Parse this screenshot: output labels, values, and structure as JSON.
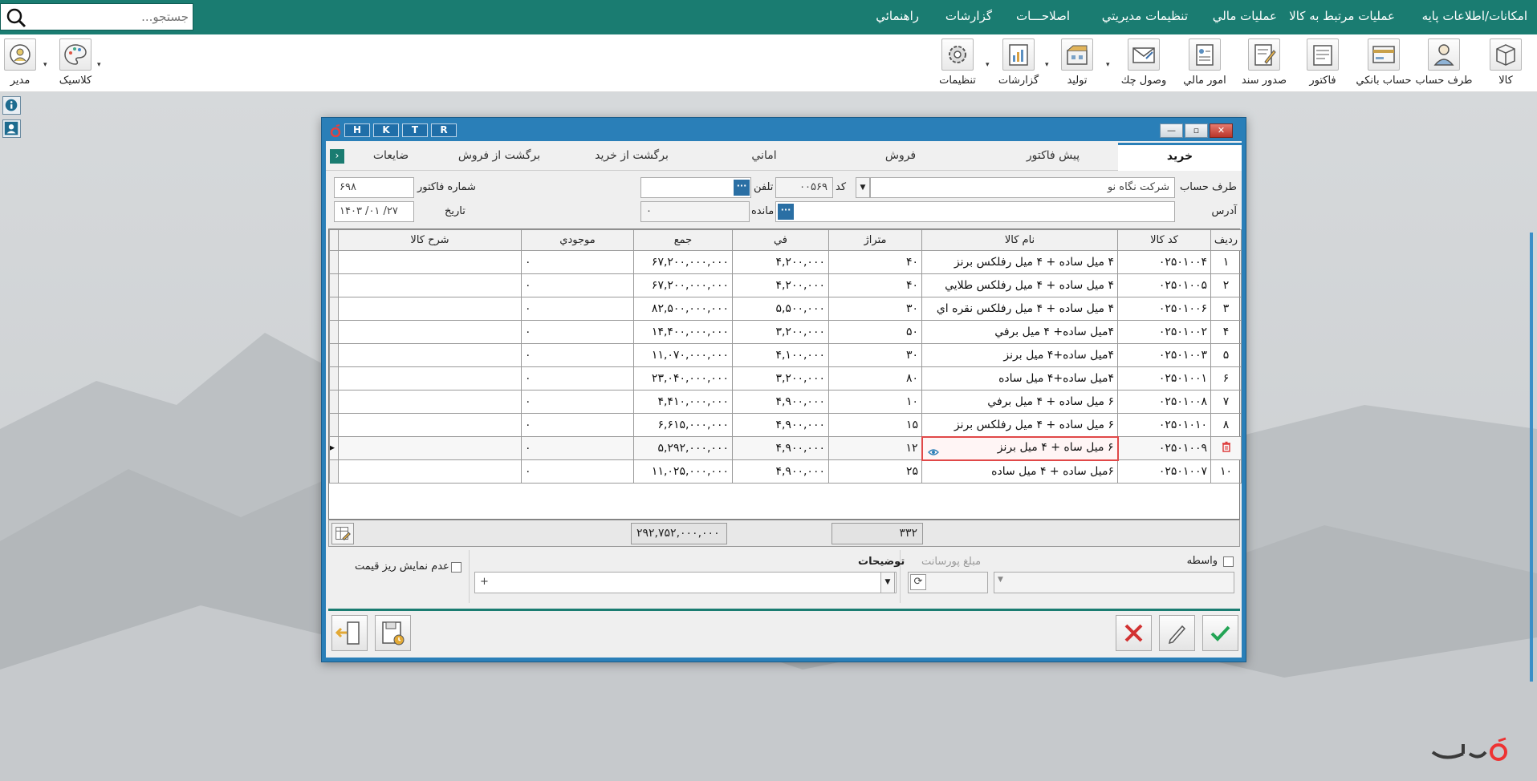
{
  "menubar": {
    "items": [
      "امکانات/اطلاعات پایه",
      "عملیات مرتبط به کالا",
      "عملیات مالي",
      "تنظيمات مديريتي",
      "اصلاحـــات",
      "گزارشات",
      "راهنمائي"
    ],
    "search_placeholder": "جستجو..."
  },
  "toolbar": {
    "items": [
      "کالا",
      "طرف حساب",
      "حساب بانکي",
      "فاکتور",
      "صدور سند",
      "امور مالي",
      "وصول چك",
      "توليد",
      "گزارشات",
      "تنظيمات"
    ],
    "left_items": [
      "مدیر",
      "کلاسیک"
    ]
  },
  "dialog": {
    "letter_buttons": [
      "H",
      "K",
      "T",
      "R"
    ],
    "tabs": [
      "خرید",
      "پیش فاکتور",
      "فروش",
      "اماني",
      "برگشت از خرید",
      "برگشت از فروش",
      "ضایعات"
    ],
    "active_tab": "خرید",
    "header": {
      "account_label": "طرف حساب",
      "account_value": "شرکت نگاه نو",
      "code_label": "کد",
      "code_value": "۰۰۵۶۹",
      "phone_label": "تلفن",
      "phone_value": "",
      "invoice_no_label": "شماره فاکتور",
      "invoice_no_value": "۶۹۸",
      "address_label": "آدرس",
      "address_value": "",
      "balance_label": "مانده",
      "balance_value": "۰",
      "date_label": "تاریخ",
      "date_value": "۱۴۰۳ /۰۱ /۲۷"
    },
    "grid": {
      "columns": [
        "ردیف",
        "کد کالا",
        "نام کالا",
        "متراژ",
        "في",
        "جمع",
        "موجودي",
        "شرح کالا"
      ],
      "rows": [
        {
          "row": "۱",
          "code": "۰۲۵۰۱۰۰۴",
          "name": "۴ میل ساده + ۴ میل رفلکس برنز",
          "qty": "۴۰",
          "price": "۴,۲۰۰,۰۰۰",
          "total": "۶۷,۲۰۰,۰۰۰,۰۰۰",
          "stock": "۰",
          "desc": ""
        },
        {
          "row": "۲",
          "code": "۰۲۵۰۱۰۰۵",
          "name": "۴ میل ساده + ۴ میل رفلکس طلایي",
          "qty": "۴۰",
          "price": "۴,۲۰۰,۰۰۰",
          "total": "۶۷,۲۰۰,۰۰۰,۰۰۰",
          "stock": "۰",
          "desc": ""
        },
        {
          "row": "۳",
          "code": "۰۲۵۰۱۰۰۶",
          "name": "۴ میل ساده + ۴ میل رفلکس نقره اي",
          "qty": "۳۰",
          "price": "۵,۵۰۰,۰۰۰",
          "total": "۸۲,۵۰۰,۰۰۰,۰۰۰",
          "stock": "۰",
          "desc": ""
        },
        {
          "row": "۴",
          "code": "۰۲۵۰۱۰۰۲",
          "name": "۴میل ساده+ ۴ میل برفي",
          "qty": "۵۰",
          "price": "۳,۲۰۰,۰۰۰",
          "total": "۱۴,۴۰۰,۰۰۰,۰۰۰",
          "stock": "۰",
          "desc": ""
        },
        {
          "row": "۵",
          "code": "۰۲۵۰۱۰۰۳",
          "name": "۴میل ساده+۴ میل برنز",
          "qty": "۳۰",
          "price": "۴,۱۰۰,۰۰۰",
          "total": "۱۱,۰۷۰,۰۰۰,۰۰۰",
          "stock": "۰",
          "desc": ""
        },
        {
          "row": "۶",
          "code": "۰۲۵۰۱۰۰۱",
          "name": "۴میل ساده+۴ میل ساده",
          "qty": "۸۰",
          "price": "۳,۲۰۰,۰۰۰",
          "total": "۲۳,۰۴۰,۰۰۰,۰۰۰",
          "stock": "۰",
          "desc": ""
        },
        {
          "row": "۷",
          "code": "۰۲۵۰۱۰۰۸",
          "name": "۶ میل ساده + ۴ میل برفي",
          "qty": "۱۰",
          "price": "۴,۹۰۰,۰۰۰",
          "total": "۴,۴۱۰,۰۰۰,۰۰۰",
          "stock": "۰",
          "desc": ""
        },
        {
          "row": "۸",
          "code": "۰۲۵۰۱۰۱۰",
          "name": "۶ میل ساده + ۴ میل رفلکس برنز",
          "qty": "۱۵",
          "price": "۴,۹۰۰,۰۰۰",
          "total": "۶,۶۱۵,۰۰۰,۰۰۰",
          "stock": "۰",
          "desc": ""
        },
        {
          "row": "",
          "code": "۰۲۵۰۱۰۰۹",
          "name": "۶ میل ساه + ۴ میل برنز",
          "qty": "۱۲",
          "price": "۴,۹۰۰,۰۰۰",
          "total": "۵,۲۹۲,۰۰۰,۰۰۰",
          "stock": "۰",
          "desc": ""
        },
        {
          "row": "۱۰",
          "code": "۰۲۵۰۱۰۰۷",
          "name": "۶میل ساده + ۴ میل ساده",
          "qty": "۲۵",
          "price": "۴,۹۰۰,۰۰۰",
          "total": "۱۱,۰۲۵,۰۰۰,۰۰۰",
          "stock": "۰",
          "desc": ""
        }
      ],
      "sum_total": "۲۹۲,۷۵۲,۰۰۰,۰۰۰",
      "sum_qty": "۳۳۲"
    },
    "lower": {
      "broker_label": "واسطه",
      "commission_label": "مبلغ پورسانت",
      "notes_label": "توضيحات",
      "notes_value": "+",
      "hide_price_label": "عدم نمایش ریز قیمت"
    }
  }
}
